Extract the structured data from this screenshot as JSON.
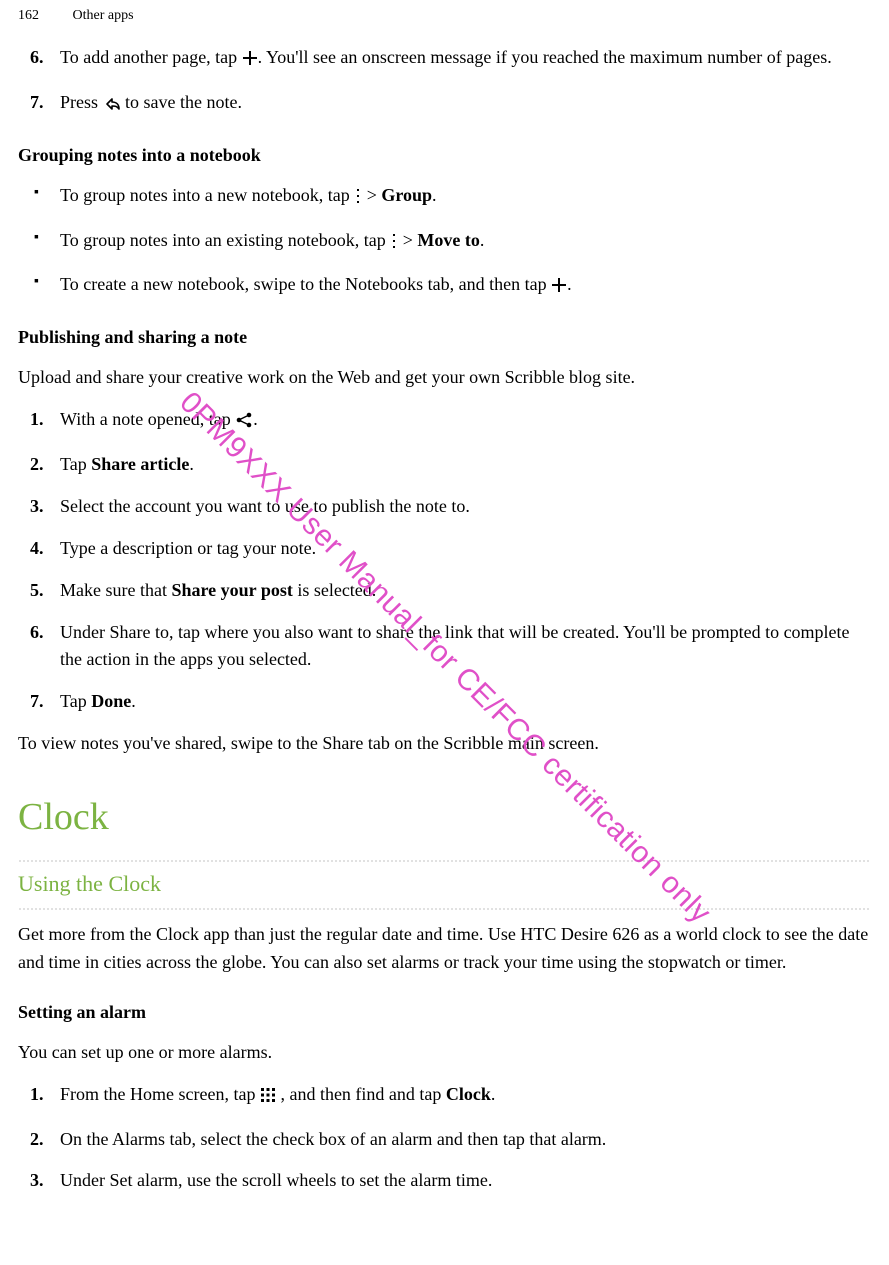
{
  "page_number": "162",
  "chapter": "Other apps",
  "step6_a": "To add another page, tap ",
  "step6_b": ". You'll see an onscreen message if you reached the maximum number of pages.",
  "step7_a": "Press ",
  "step7_b": " to save the note.",
  "heading_group": "Grouping notes into a notebook",
  "bullet1_a": "To group notes into a new notebook, tap ",
  "bullet1_b": " > ",
  "bullet1_c": "Group",
  "bullet1_d": ".",
  "bullet2_a": "To group notes into an existing notebook, tap ",
  "bullet2_b": " > ",
  "bullet2_c": "Move to",
  "bullet2_d": ".",
  "bullet3_a": "To create a new notebook, swipe to the Notebooks tab, and then tap ",
  "bullet3_b": ".",
  "heading_publish": "Publishing and sharing a note",
  "publish_intro": "Upload and share your creative work on the Web and get your own Scribble blog site.",
  "pub1_a": "With a note opened, tap ",
  "pub1_b": ".",
  "pub2_a": "Tap ",
  "pub2_b": "Share article",
  "pub2_c": ".",
  "pub3": "Select the account you want to use to publish the note to.",
  "pub4": "Type a description or tag your note.",
  "pub5_a": "Make sure that ",
  "pub5_b": "Share your post",
  "pub5_c": " is selected.",
  "pub6": "Under Share to, tap where you also want to share the link that will be created. You'll be prompted to complete the action in the apps you selected.",
  "pub7_a": "Tap ",
  "pub7_b": "Done",
  "pub7_c": ".",
  "pub_outro": "To view notes you've shared, swipe to the Share tab on the Scribble main screen.",
  "h1_clock": "Clock",
  "h2_using": "Using the Clock",
  "clock_intro": "Get more from the Clock app than just the regular date and time. Use HTC Desire 626 as a world clock to see the date and time in cities across the globe. You can also set alarms or track your time using the stopwatch or timer.",
  "heading_alarm": "Setting an alarm",
  "alarm_intro": "You can set up one or more alarms.",
  "al1_a": "From the Home screen, tap ",
  "al1_b": " , and then find and tap ",
  "al1_c": "Clock",
  "al1_d": ".",
  "al2": "On the Alarms tab, select the check box of an alarm and then tap that alarm.",
  "al3": "Under Set alarm, use the scroll wheels to set the alarm time.",
  "nums": {
    "n1": "1.",
    "n2": "2.",
    "n3": "3.",
    "n4": "4.",
    "n5": "5.",
    "n6": "6.",
    "n7": "7."
  },
  "watermark": "0PM9XXX User Manual_for CE/FCC certification only"
}
